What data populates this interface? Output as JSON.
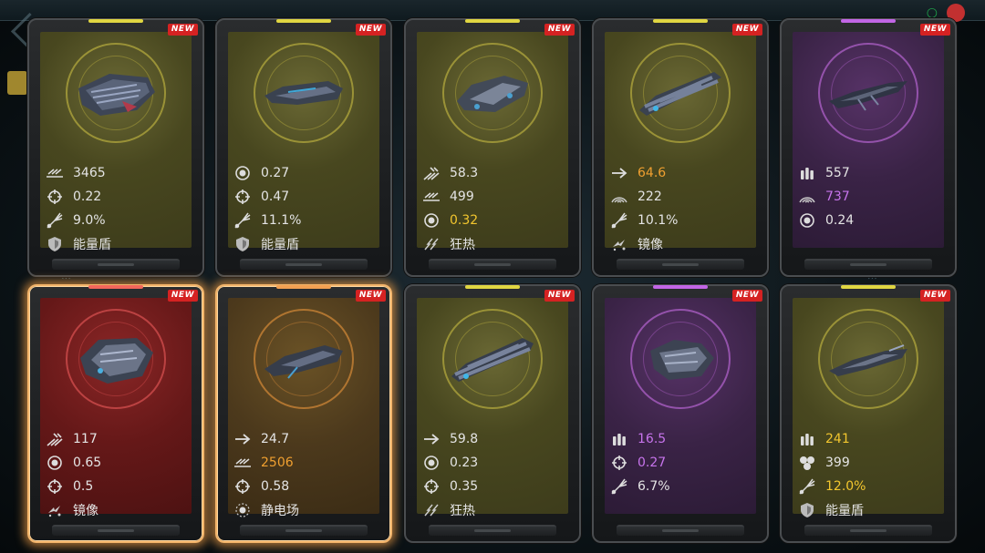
{
  "colors": {
    "olive": "#4b4a24",
    "purple": "#3a2446",
    "red": "#6a1b1b",
    "bronze": "#4d3a1d",
    "value_white": "#e4e4e4",
    "value_orange": "#f0a030",
    "value_yellow": "#f2c62e",
    "value_purple": "#c774ec",
    "new_badge": "#d52222"
  },
  "cards": [
    {
      "tier": "olive",
      "badge": "NEW",
      "stats": [
        {
          "icon": "speed-lines-icon",
          "value": "3465",
          "color": "white"
        },
        {
          "icon": "crosshair-icon",
          "value": "0.22",
          "color": "white"
        },
        {
          "icon": "spread-shot-icon",
          "value": "9.0%",
          "color": "white"
        },
        {
          "icon": "shield-icon",
          "value": "能量盾",
          "color": "white"
        }
      ]
    },
    {
      "tier": "olive",
      "badge": "NEW",
      "stats": [
        {
          "icon": "target-circle-icon",
          "value": "0.27",
          "color": "white"
        },
        {
          "icon": "crosshair-icon",
          "value": "0.47",
          "color": "white"
        },
        {
          "icon": "spread-shot-icon",
          "value": "11.1%",
          "color": "white"
        },
        {
          "icon": "shield-icon",
          "value": "能量盾",
          "color": "white"
        }
      ]
    },
    {
      "tier": "olive",
      "badge": "NEW",
      "stats": [
        {
          "icon": "burst-arrows-icon",
          "value": "58.3",
          "color": "white"
        },
        {
          "icon": "speed-lines-icon",
          "value": "499",
          "color": "white"
        },
        {
          "icon": "target-circle-icon",
          "value": "0.32",
          "color": "yellow"
        },
        {
          "icon": "frenzy-icon",
          "value": "狂热",
          "color": "white"
        }
      ]
    },
    {
      "tier": "olive",
      "badge": "NEW",
      "stats": [
        {
          "icon": "arrow-right-icon",
          "value": "64.6",
          "color": "orange"
        },
        {
          "icon": "radar-arc-icon",
          "value": "222",
          "color": "white"
        },
        {
          "icon": "spread-shot-icon",
          "value": "10.1%",
          "color": "white"
        },
        {
          "icon": "mirror-icon",
          "value": "镜像",
          "color": "white"
        }
      ]
    },
    {
      "tier": "purple",
      "badge": "NEW",
      "stats": [
        {
          "icon": "ammo-icon",
          "value": "557",
          "color": "white"
        },
        {
          "icon": "radar-arc-icon",
          "value": "737",
          "color": "purple"
        },
        {
          "icon": "target-circle-icon",
          "value": "0.24",
          "color": "white"
        }
      ]
    },
    {
      "tier": "red",
      "badge": "NEW",
      "selected": true,
      "stats": [
        {
          "icon": "burst-arrows-icon",
          "value": "117",
          "color": "white"
        },
        {
          "icon": "target-circle-icon",
          "value": "0.65",
          "color": "white"
        },
        {
          "icon": "crosshair-icon",
          "value": "0.5",
          "color": "white"
        },
        {
          "icon": "mirror-icon",
          "value": "镜像",
          "color": "white"
        }
      ]
    },
    {
      "tier": "bronze",
      "badge": "NEW",
      "selected": true,
      "stats": [
        {
          "icon": "arrow-right-icon",
          "value": "24.7",
          "color": "white"
        },
        {
          "icon": "speed-lines-icon",
          "value": "2506",
          "color": "orange"
        },
        {
          "icon": "crosshair-icon",
          "value": "0.58",
          "color": "white"
        },
        {
          "icon": "static-field-icon",
          "value": "静电场",
          "color": "white"
        }
      ]
    },
    {
      "tier": "olive",
      "badge": "NEW",
      "stats": [
        {
          "icon": "arrow-right-icon",
          "value": "59.8",
          "color": "white"
        },
        {
          "icon": "target-circle-icon",
          "value": "0.23",
          "color": "white"
        },
        {
          "icon": "crosshair-icon",
          "value": "0.35",
          "color": "white"
        },
        {
          "icon": "frenzy-icon",
          "value": "狂热",
          "color": "white"
        }
      ]
    },
    {
      "tier": "purple",
      "badge": "NEW",
      "stats": [
        {
          "icon": "ammo-icon",
          "value": "16.5",
          "color": "purple"
        },
        {
          "icon": "crosshair-icon",
          "value": "0.27",
          "color": "purple"
        },
        {
          "icon": "spread-shot-icon",
          "value": "6.7%",
          "color": "white"
        }
      ]
    },
    {
      "tier": "olive",
      "badge": "NEW",
      "stats": [
        {
          "icon": "ammo-icon",
          "value": "241",
          "color": "yellow"
        },
        {
          "icon": "cluster-icon",
          "value": "399",
          "color": "white"
        },
        {
          "icon": "spread-shot-icon",
          "value": "12.0%",
          "color": "yellow"
        },
        {
          "icon": "shield-icon",
          "value": "能量盾",
          "color": "white"
        }
      ]
    }
  ]
}
